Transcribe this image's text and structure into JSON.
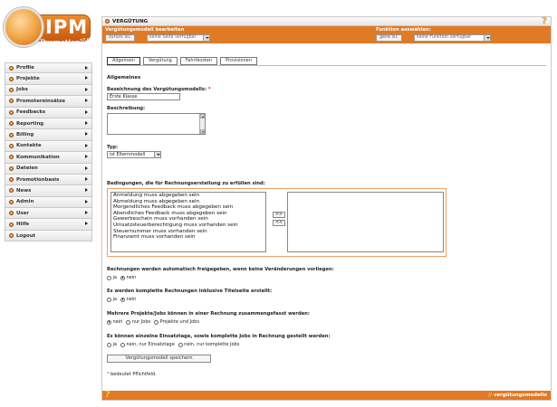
{
  "logo": {
    "main": "IPM",
    "sub": "Promotion",
    "version": "v2.0"
  },
  "sidebar": {
    "items": [
      {
        "label": "Profile",
        "has_sub": true
      },
      {
        "label": "Projekte",
        "has_sub": true
      },
      {
        "label": "Jobs",
        "has_sub": true
      },
      {
        "label": "Promotereinsätze",
        "has_sub": true
      },
      {
        "label": "Feedbacks",
        "has_sub": true
      },
      {
        "label": "Reporting",
        "has_sub": true
      },
      {
        "label": "Billing",
        "has_sub": true
      },
      {
        "label": "Kontakte",
        "has_sub": true
      },
      {
        "label": "Kommunikation",
        "has_sub": true
      },
      {
        "label": "Dateien",
        "has_sub": true
      },
      {
        "label": "Promotionbasis",
        "has_sub": true
      },
      {
        "label": "News",
        "has_sub": true
      },
      {
        "label": "Admin",
        "has_sub": true
      },
      {
        "label": "User",
        "has_sub": true
      },
      {
        "label": "Hilfe",
        "has_sub": true
      },
      {
        "label": "Logout",
        "has_sub": false
      }
    ]
  },
  "header": {
    "title": "VERGÜTUNG",
    "left_label": "Vergütungsmodell bearbeiten",
    "back_button": "zurück zu:",
    "back_select": "keine Seite verfügbar",
    "right_label": "Funktion auswählen:",
    "go_button": "gehe zu:",
    "go_select": "keine Funktion verfügbar"
  },
  "tabs": [
    {
      "label": "Allgemein",
      "active": true
    },
    {
      "label": "Vergütung",
      "active": false
    },
    {
      "label": "Fahrtkosten",
      "active": false
    },
    {
      "label": "Provisionen",
      "active": false
    }
  ],
  "form": {
    "section": "Allgemeines",
    "name_label": "Bezeichnung des Vergütungsmodells:",
    "required_mark": "*",
    "name_value": "Erste Klasse",
    "description_label": "Beschreibung:",
    "type_label": "Typ:",
    "type_value": "ist Elternmodell",
    "conditions_label": "Bedingungen, die für Rechnungserstellung zu erfüllen sind:",
    "conditions": [
      "Anmeldung muss abgegeben sein",
      "Abmeldung muss abgegeben sein",
      "Morgendliches Feedback muss abgegeben sein",
      "Abendliches Feedback muss abgegeben sein",
      "Gewerbeschein muss vorhanden sein",
      "Umsatzsteuerberechtigung muss vorhanden sein",
      "Steuernummer muss vorhanden sein",
      "Finanzamt muss vorhanden sein"
    ],
    "add_button": ">>",
    "remove_button": "<<",
    "q1": {
      "label": "Rechnungen werden automatisch freigegeben, wenn keine Veränderungen vorliegen:",
      "options": [
        {
          "label": "ja",
          "checked": false
        },
        {
          "label": "nein",
          "checked": true
        }
      ]
    },
    "q2": {
      "label": "Es werden komplette Rechnungen inklusive Titelseite erstellt:",
      "options": [
        {
          "label": "ja",
          "checked": false
        },
        {
          "label": "nein",
          "checked": true
        }
      ]
    },
    "q3": {
      "label": "Mehrere Projekte/Jobs können in einer Rechnung zusammengefasst werden:",
      "options": [
        {
          "label": "nein",
          "checked": true
        },
        {
          "label": "nur Jobs",
          "checked": false
        },
        {
          "label": "Projekte und Jobs",
          "checked": false
        }
      ]
    },
    "q4": {
      "label": "Es können einzelne Einsatztage, sowie komplette Jobs in Rechnung gestellt werden:",
      "options": [
        {
          "label": "ja",
          "checked": false
        },
        {
          "label": "nein, nur Einsatztage",
          "checked": false
        },
        {
          "label": "nein, nur komplette Jobs",
          "checked": false
        }
      ]
    },
    "save_button": "Vergütungsmodell speichern",
    "note_mark": "*",
    "note_text": "bedeutet Pflichtfeld."
  },
  "footer": {
    "slashes": "//",
    "text": "vergütungsmodelle"
  },
  "colors": {
    "accent": "#e07a25",
    "required": "#dd2222"
  }
}
